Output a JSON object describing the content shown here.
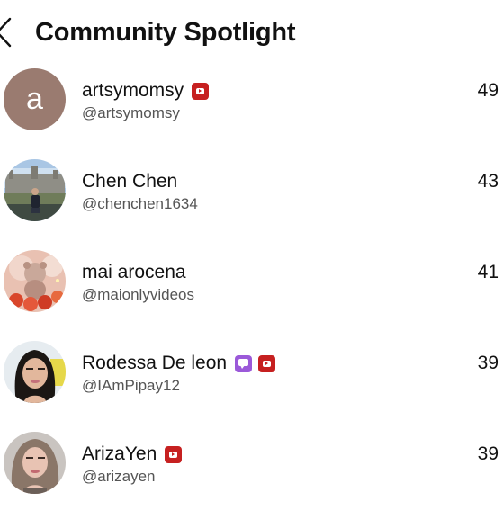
{
  "header": {
    "back_icon": "chevron-left-icon",
    "title": "Community Spotlight"
  },
  "users": [
    {
      "display_name": "artsymomsy",
      "handle": "@artsymomsy",
      "count": "49",
      "avatar": {
        "type": "letter",
        "letter": "a",
        "color": "#9a7b70"
      },
      "badges": [
        "youtube-icon"
      ]
    },
    {
      "display_name": "Chen Chen",
      "handle": "@chenchen1634",
      "count": "43",
      "avatar": {
        "type": "photo",
        "subject": "person in front of building"
      },
      "badges": []
    },
    {
      "display_name": "mai arocena",
      "handle": "@maionlyvideos",
      "count": "41",
      "avatar": {
        "type": "photo",
        "subject": "teddy bear with flowers"
      },
      "badges": []
    },
    {
      "display_name": "Rodessa De leon",
      "handle": "@IAmPipay12",
      "count": "39",
      "avatar": {
        "type": "photo",
        "subject": "woman selfie"
      },
      "badges": [
        "chat-icon",
        "youtube-icon"
      ]
    },
    {
      "display_name": "ArizaYen",
      "handle": "@arizayen",
      "count": "39",
      "avatar": {
        "type": "photo",
        "subject": "woman selfie"
      },
      "badges": [
        "youtube-icon"
      ]
    }
  ],
  "colors": {
    "youtube_badge": "#c62020",
    "chat_badge": "#9b59d9",
    "handle_text": "#555555"
  }
}
